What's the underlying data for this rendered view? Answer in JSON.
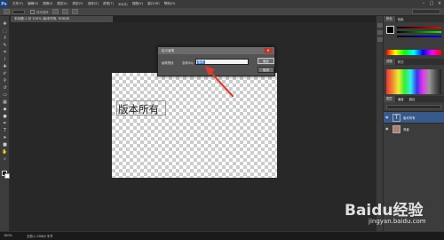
{
  "app": {
    "logo": "Ps"
  },
  "menu": [
    "文件(F)",
    "编辑(E)",
    "图像(I)",
    "图层(L)",
    "类型(Y)",
    "选择(S)",
    "滤镜(T)",
    "3D(D)",
    "视图(V)",
    "窗口(W)",
    "帮助(H)"
  ],
  "window_buttons": [
    "–",
    "□",
    "×"
  ],
  "options_bar": {
    "checkbox_label": "自动选择"
  },
  "document": {
    "tab_label": "未标题-1 @ 100% (版本所有, RGB/8)",
    "canvas_text": "版本所有"
  },
  "dialog": {
    "title": "定义画笔",
    "close_label": "×",
    "dictionary_label": "画笔预设",
    "name_label": "名称(N):",
    "name_value": "版本",
    "ok_label": "确定",
    "cancel_label": "取消"
  },
  "panels": {
    "color_tabs": [
      "颜色",
      "色板"
    ],
    "adjust_tabs": [
      "调整",
      "样式"
    ],
    "layers_tabs": [
      "图层",
      "通道",
      "路径"
    ],
    "layers": [
      {
        "thumb": "T",
        "name": "版本所有",
        "selected": true
      },
      {
        "thumb": "",
        "name": "背景",
        "selected": false
      }
    ]
  },
  "status": {
    "zoom": "100%",
    "doc_size": "文档:1.19M/0 字节"
  },
  "watermark": {
    "logo": "Baidu经验",
    "url": "jingyan.baidu.com"
  },
  "colors": {
    "accent_arrow": "#e23a2c",
    "selection": "#3b79d6",
    "foreground": "#000000",
    "background": "#ffffff"
  }
}
